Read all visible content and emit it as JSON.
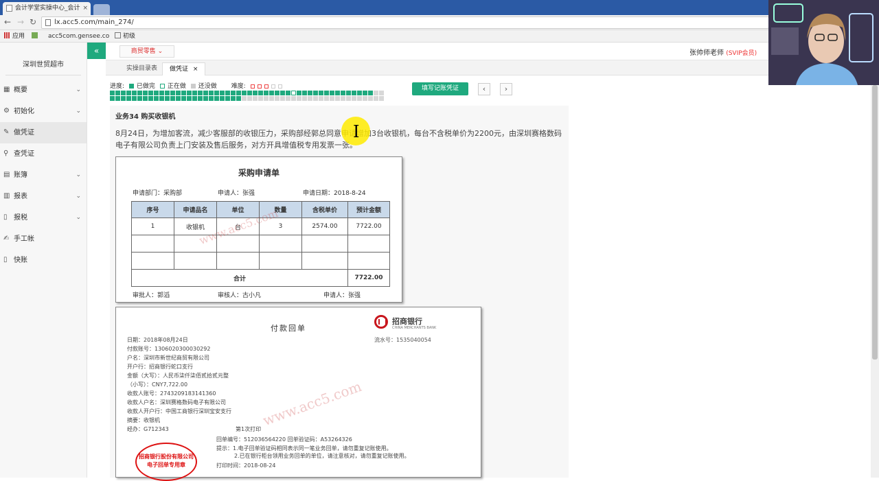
{
  "browser": {
    "tab_title": "会计学堂实操中心_会计",
    "tab_close": "×",
    "url": "lx.acc5.com/main_274/",
    "bookmarks": [
      "应用",
      "acc5com.gensee.co",
      "初级"
    ]
  },
  "sidebar": {
    "company": "深圳世贸超市",
    "items": [
      {
        "label": "概要",
        "icon": "grid-icon",
        "chevron": "⌄"
      },
      {
        "label": "初始化",
        "icon": "gear-icon",
        "chevron": "⌄"
      },
      {
        "label": "做凭证",
        "icon": "pen-icon",
        "chevron": ""
      },
      {
        "label": "查凭证",
        "icon": "search-icon",
        "chevron": ""
      },
      {
        "label": "账簿",
        "icon": "book-icon",
        "chevron": "⌄"
      },
      {
        "label": "报表",
        "icon": "report-icon",
        "chevron": "⌄"
      },
      {
        "label": "报税",
        "icon": "file-icon",
        "chevron": "⌄"
      },
      {
        "label": "手工帐",
        "icon": "hand-pen-icon",
        "chevron": ""
      },
      {
        "label": "快账",
        "icon": "doc-icon",
        "chevron": ""
      }
    ]
  },
  "topbar": {
    "collapse": "«",
    "dropdown": "商贸零售 ⌄",
    "teacher": "张帅师老师",
    "vip": "(SVIP会员)"
  },
  "tabs": [
    {
      "label": "实操目录表"
    },
    {
      "label": "做凭证",
      "close": "×"
    }
  ],
  "progress": {
    "label": "进度:",
    "done": "已做完",
    "doing": "正在做",
    "todo": "还没做",
    "difficulty_label": "难度:",
    "difficulty_level": 3,
    "difficulty_max": 5,
    "completed_cells": 49,
    "total_cells": 100,
    "colors": {
      "done": "#1fa97e",
      "doing": "#ffffff",
      "todo": "#d8d8d8",
      "accent": "#1fa97e"
    },
    "fill_button": "填写记账凭证",
    "prev": "‹",
    "next": "›"
  },
  "task": {
    "title": "业务34 购买收银机",
    "description": "8月24日，为增加客流，减少客服部的收银压力，采购部经郭总同意申请增加3台收银机，每台不含税单价为2200元，由深圳赛格数码电子有限公司负责上门安装及售后服务，对方开具增值税专用发票一张。"
  },
  "requisition": {
    "title": "采购申请单",
    "dept": "申请部门：采购部",
    "applicant": "申请人：张强",
    "date": "申请日期：2018-8-24",
    "headers": [
      "序号",
      "申请品名",
      "单位",
      "数量",
      "含税单价",
      "预计金额"
    ],
    "rows": [
      [
        "1",
        "收银机",
        "台",
        "3",
        "2574.00",
        "7722.00"
      ],
      [
        "",
        "",
        "",
        "",
        "",
        ""
      ],
      [
        "",
        "",
        "",
        "",
        "",
        ""
      ]
    ],
    "total_label": "合计",
    "total_value": "7722.00",
    "approver": "审批人：郭滔",
    "reviewer": "审核人：古小凡",
    "requester": "申请人：张强",
    "watermark": "www.acc5.com"
  },
  "receipt": {
    "title": "付款回单",
    "bank": "招商银行",
    "bank_en": "CHINA MERCHANTS BANK",
    "serial": "流水号：1535040054",
    "lines": [
      "日期：2018年08月24日",
      "付款账号：1306020300030292",
      "户名：深圳市新世纪商贸有限公司",
      "开户行：招商银行蛇口支行",
      "金额（大写）：人民币柒仟柒佰贰拾贰元整",
      "（小写）：CNY7,722.00",
      "收款人账号：2743209183141360",
      "收款人户名：深圳赛格数码电子有限公司",
      "收款人开户行：中国工商银行深圳宝安支行",
      "摘要：收银机",
      "经办：G712343"
    ],
    "print_count": "第1次打印",
    "receipt_no": "回单编号：512036564220 回单验证码：A53264326",
    "tip1": "提示：1.电子回单验证码相同表示同一笔业务回单，请勿重复记账使用。",
    "tip2": "2.已在银行柜台领用业务回单的单位，请注意核对，请勿重复记账使用。",
    "print_time": "打印时间：2018-08-24",
    "stamp_line1": "招商银行股份有限公司",
    "stamp_line2": "电子回单专用章",
    "watermark": "www.acc5.com"
  }
}
